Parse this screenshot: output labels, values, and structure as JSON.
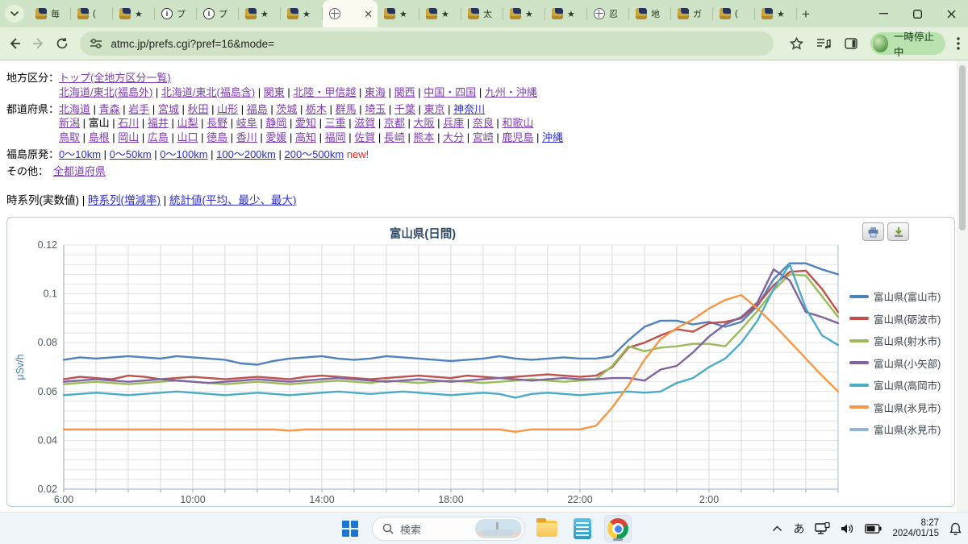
{
  "browser": {
    "tabs": [
      {
        "favicon": "chart",
        "title": "毎"
      },
      {
        "favicon": "chart",
        "title": "("
      },
      {
        "favicon": "chart",
        "title": "★"
      },
      {
        "favicon": "info",
        "title": "プ"
      },
      {
        "favicon": "info",
        "title": "プ"
      },
      {
        "favicon": "chart",
        "title": "★"
      },
      {
        "favicon": "chart",
        "title": "★"
      },
      {
        "favicon": "globe",
        "title": "",
        "active": true
      },
      {
        "favicon": "chart",
        "title": "★"
      },
      {
        "favicon": "chart",
        "title": "★"
      },
      {
        "favicon": "chart",
        "title": "太"
      },
      {
        "favicon": "chart",
        "title": "★"
      },
      {
        "favicon": "chart",
        "title": "★"
      },
      {
        "favicon": "globe",
        "title": "忍"
      },
      {
        "favicon": "chart",
        "title": "地"
      },
      {
        "favicon": "chart",
        "title": "ガ"
      },
      {
        "favicon": "chart",
        "title": "("
      },
      {
        "favicon": "chart",
        "title": "★"
      }
    ],
    "url": "atmc.jp/prefs.cgi?pref=16&mode=",
    "profile_chip_label": "一時停止中"
  },
  "page": {
    "nav_rows": [
      {
        "label": "地方区分：",
        "lines": [
          [
            {
              "t": "トップ(全地方区分一覧)",
              "c": "v"
            }
          ],
          [
            {
              "t": "北海道/東北(福島外)",
              "c": "v"
            },
            {
              "t": "北海道/東北(福島含)",
              "c": "v"
            },
            {
              "t": "関東",
              "c": "v"
            },
            {
              "t": "北陸・甲信越",
              "c": "v"
            },
            {
              "t": "東海",
              "c": "v"
            },
            {
              "t": "関西",
              "c": "v"
            },
            {
              "t": "中国・四国",
              "c": "v"
            },
            {
              "t": "九州・沖縄",
              "c": "v"
            }
          ]
        ]
      },
      {
        "label": "都道府県：",
        "lines": [
          [
            {
              "t": "北海道",
              "c": "v"
            },
            {
              "t": "青森",
              "c": "v"
            },
            {
              "t": "岩手",
              "c": "v"
            },
            {
              "t": "宮城",
              "c": "v"
            },
            {
              "t": "秋田",
              "c": "v"
            },
            {
              "t": "山形",
              "c": "v"
            },
            {
              "t": "福島",
              "c": "v"
            },
            {
              "t": "茨城",
              "c": "v"
            },
            {
              "t": "栃木",
              "c": "v"
            },
            {
              "t": "群馬",
              "c": "v"
            },
            {
              "t": "埼玉",
              "c": "v"
            },
            {
              "t": "千葉",
              "c": "v"
            },
            {
              "t": "東京",
              "c": "v"
            },
            {
              "t": "神奈川",
              "c": "b"
            }
          ],
          [
            {
              "t": "新潟",
              "c": "v"
            },
            {
              "t": "富山",
              "c": "k"
            },
            {
              "t": "石川",
              "c": "v"
            },
            {
              "t": "福井",
              "c": "v"
            },
            {
              "t": "山梨",
              "c": "v"
            },
            {
              "t": "長野",
              "c": "v"
            },
            {
              "t": "岐阜",
              "c": "v"
            },
            {
              "t": "静岡",
              "c": "v"
            },
            {
              "t": "愛知",
              "c": "v"
            },
            {
              "t": "三重",
              "c": "v"
            },
            {
              "t": "滋賀",
              "c": "v"
            },
            {
              "t": "京都",
              "c": "v"
            },
            {
              "t": "大阪",
              "c": "v"
            },
            {
              "t": "兵庫",
              "c": "v"
            },
            {
              "t": "奈良",
              "c": "v"
            },
            {
              "t": "和歌山",
              "c": "v"
            }
          ],
          [
            {
              "t": "鳥取",
              "c": "v"
            },
            {
              "t": "島根",
              "c": "v"
            },
            {
              "t": "岡山",
              "c": "v"
            },
            {
              "t": "広島",
              "c": "v"
            },
            {
              "t": "山口",
              "c": "v"
            },
            {
              "t": "徳島",
              "c": "v"
            },
            {
              "t": "香川",
              "c": "v"
            },
            {
              "t": "愛媛",
              "c": "v"
            },
            {
              "t": "高知",
              "c": "v"
            },
            {
              "t": "福岡",
              "c": "v"
            },
            {
              "t": "佐賀",
              "c": "v"
            },
            {
              "t": "長崎",
              "c": "v"
            },
            {
              "t": "熊本",
              "c": "v"
            },
            {
              "t": "大分",
              "c": "v"
            },
            {
              "t": "宮崎",
              "c": "v"
            },
            {
              "t": "鹿児島",
              "c": "v"
            },
            {
              "t": "沖縄",
              "c": "b"
            }
          ]
        ]
      },
      {
        "label": "福島原発：",
        "lines": [
          [
            {
              "t": "0〜10km",
              "c": "b"
            },
            {
              "t": "0〜50km",
              "c": "b"
            },
            {
              "t": "0〜100km",
              "c": "b"
            },
            {
              "t": "100〜200km",
              "c": "b"
            },
            {
              "t": "200〜500km",
              "c": "b"
            },
            {
              "t": "new!",
              "c": "r",
              "sep": false
            }
          ]
        ]
      },
      {
        "label": "その他：",
        "lines": [
          [
            {
              "t": "全都道府県",
              "c": "v"
            }
          ]
        ]
      }
    ],
    "view_tabs": [
      {
        "t": "時系列(実数値)",
        "c": "k"
      },
      {
        "t": "時系列(増減率)",
        "c": "b"
      },
      {
        "t": "統計値(平均、最少、最大)",
        "c": "b"
      }
    ]
  },
  "chart_data": {
    "type": "line",
    "title": "富山県(日間)",
    "ylabel": "μSv/h",
    "ylim": [
      0.02,
      0.12
    ],
    "y_major": 0.02,
    "y_minor": 0.004,
    "x_hours_span": 24,
    "x_step_hours": 0.5,
    "x_start_label_hour": 6,
    "x_ticks": [
      {
        "t": 0,
        "label": "6:00"
      },
      {
        "t": 4,
        "label": "10:00"
      },
      {
        "t": 8,
        "label": "14:00"
      },
      {
        "t": 12,
        "label": "18:00"
      },
      {
        "t": 16,
        "label": "22:00"
      },
      {
        "t": 20,
        "label": "2:00"
      }
    ],
    "grid": true,
    "legend_position": "right",
    "series": [
      {
        "name": "富山県(富山市)",
        "color": "#4F81BD",
        "values": [
          0.073,
          0.074,
          0.0735,
          0.074,
          0.0745,
          0.074,
          0.0735,
          0.0745,
          0.074,
          0.0735,
          0.073,
          0.0715,
          0.071,
          0.0725,
          0.0735,
          0.074,
          0.0745,
          0.0735,
          0.073,
          0.0735,
          0.0745,
          0.074,
          0.0735,
          0.073,
          0.0725,
          0.073,
          0.0735,
          0.0745,
          0.0735,
          0.073,
          0.0735,
          0.074,
          0.0735,
          0.0735,
          0.0745,
          0.081,
          0.0865,
          0.089,
          0.089,
          0.0875,
          0.0885,
          0.0865,
          0.0885,
          0.095,
          0.106,
          0.1125,
          0.1125,
          0.11,
          0.108
        ]
      },
      {
        "name": "富山県(砺波市)",
        "color": "#C0504D",
        "values": [
          0.065,
          0.066,
          0.0655,
          0.065,
          0.0665,
          0.066,
          0.065,
          0.0655,
          0.066,
          0.0655,
          0.065,
          0.0655,
          0.066,
          0.0655,
          0.065,
          0.066,
          0.0665,
          0.066,
          0.0655,
          0.065,
          0.0655,
          0.066,
          0.0665,
          0.066,
          0.0655,
          0.0665,
          0.066,
          0.0655,
          0.066,
          0.0665,
          0.067,
          0.0665,
          0.066,
          0.0665,
          0.07,
          0.078,
          0.08,
          0.083,
          0.0855,
          0.0845,
          0.088,
          0.0885,
          0.09,
          0.0955,
          0.1035,
          0.109,
          0.1095,
          0.102,
          0.0925
        ]
      },
      {
        "name": "富山県(射水市)",
        "color": "#9BBB59",
        "values": [
          0.063,
          0.0635,
          0.064,
          0.0635,
          0.063,
          0.0635,
          0.064,
          0.0645,
          0.064,
          0.0635,
          0.063,
          0.0635,
          0.064,
          0.0635,
          0.063,
          0.0635,
          0.064,
          0.0645,
          0.064,
          0.0635,
          0.0645,
          0.064,
          0.0635,
          0.064,
          0.0645,
          0.064,
          0.0635,
          0.064,
          0.0645,
          0.065,
          0.0645,
          0.064,
          0.0645,
          0.065,
          0.0705,
          0.0785,
          0.0765,
          0.078,
          0.0785,
          0.0795,
          0.0795,
          0.0785,
          0.0855,
          0.093,
          0.1015,
          0.108,
          0.1075,
          0.099,
          0.0905
        ]
      },
      {
        "name": "富山県(小矢部)",
        "color": "#8064A2",
        "values": [
          0.064,
          0.0645,
          0.065,
          0.0645,
          0.064,
          0.0645,
          0.065,
          0.0645,
          0.064,
          0.0635,
          0.064,
          0.0645,
          0.065,
          0.0645,
          0.064,
          0.0645,
          0.065,
          0.0655,
          0.065,
          0.0645,
          0.064,
          0.0645,
          0.065,
          0.0645,
          0.064,
          0.0645,
          0.065,
          0.0655,
          0.065,
          0.0645,
          0.065,
          0.0655,
          0.065,
          0.065,
          0.0655,
          0.0655,
          0.0645,
          0.069,
          0.0705,
          0.076,
          0.0825,
          0.0875,
          0.0905,
          0.0965,
          0.11,
          0.1055,
          0.0925,
          0.0905,
          0.088
        ]
      },
      {
        "name": "富山県(高岡市)",
        "color": "#4BACC6",
        "values": [
          0.0585,
          0.059,
          0.0595,
          0.059,
          0.0585,
          0.059,
          0.0595,
          0.06,
          0.0595,
          0.059,
          0.0585,
          0.059,
          0.0595,
          0.059,
          0.0585,
          0.059,
          0.0595,
          0.06,
          0.0595,
          0.059,
          0.0595,
          0.06,
          0.0595,
          0.059,
          0.0585,
          0.059,
          0.0595,
          0.059,
          0.0575,
          0.059,
          0.0595,
          0.059,
          0.0585,
          0.059,
          0.0595,
          0.06,
          0.0595,
          0.06,
          0.0635,
          0.0655,
          0.07,
          0.0735,
          0.08,
          0.089,
          0.102,
          0.112,
          0.094,
          0.083,
          0.079
        ]
      },
      {
        "name": "富山県(氷見市)",
        "color": "#F79646",
        "values": [
          0.0445,
          0.0445,
          0.0445,
          0.0445,
          0.0445,
          0.0445,
          0.0445,
          0.0445,
          0.0445,
          0.0445,
          0.0445,
          0.0445,
          0.0445,
          0.0445,
          0.044,
          0.0445,
          0.0445,
          0.0445,
          0.0445,
          0.0445,
          0.0445,
          0.0445,
          0.0445,
          0.0445,
          0.0445,
          0.0445,
          0.0445,
          0.0445,
          0.0435,
          0.0445,
          0.0445,
          0.0445,
          0.0445,
          0.046,
          0.0535,
          0.0625,
          0.073,
          0.0815,
          0.086,
          0.0895,
          0.094,
          0.0975,
          0.0995,
          0.094,
          0.0875,
          0.0805,
          0.0735,
          0.0665,
          0.06
        ]
      },
      {
        "name": "富山県(氷見市)",
        "color": "#95B3D7",
        "values": []
      }
    ]
  },
  "widget_buttons": {
    "print": "print",
    "download": "download"
  },
  "taskbar": {
    "search_placeholder": "検索",
    "ime_indicator": "あ",
    "clock_time": "8:27",
    "clock_date": "2024/01/15"
  }
}
